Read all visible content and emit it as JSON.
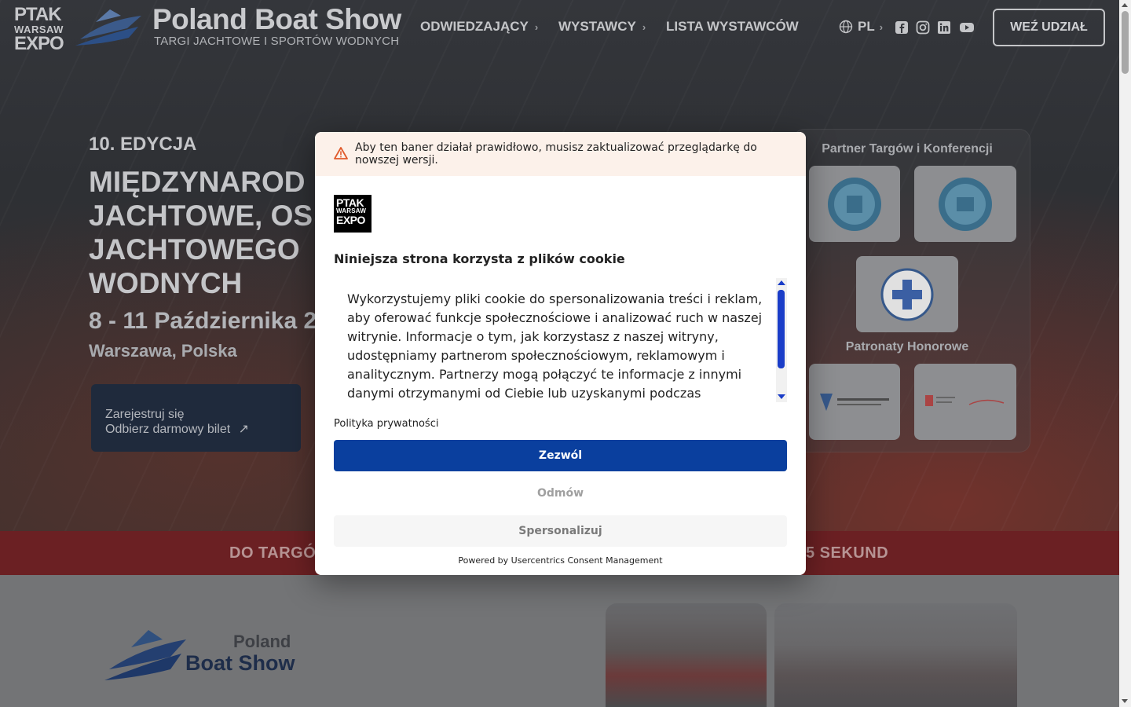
{
  "header": {
    "brand_ptak": [
      "PTAK",
      "WARSAW",
      "EXPO"
    ],
    "title": "Poland Boat Show",
    "subtitle": "TARGI JACHTOWE I SPORTÓW WODNYCH",
    "nav": [
      {
        "label": "ODWIEDZAJĄCY",
        "chevron": "›"
      },
      {
        "label": "WYSTAWCY",
        "chevron": "›"
      },
      {
        "label": "LISTA WYSTAWCÓW"
      }
    ],
    "lang": "PL",
    "lang_chevron": "›",
    "socials": [
      "facebook-icon",
      "instagram-icon",
      "linkedin-icon",
      "youtube-icon"
    ],
    "cta": "WEŹ UDZIAŁ"
  },
  "hero": {
    "edition": "10. EDYCJA",
    "title_lines": [
      "MIĘDZYNAROD",
      "JACHTOWE, OS",
      "JACHTOWEGO",
      "WODNYCH"
    ],
    "date": "8 - 11 Października 2",
    "city": "Warszawa, Polska",
    "register_line1": "Zarejestruj się",
    "register_line2": "Odbierz darmowy bilet",
    "register_arrow": "↗"
  },
  "partners": {
    "heading1": "Partner Targów i Konferencji",
    "heading2": "Patronaty Honorowe"
  },
  "countdown": {
    "left": "DO TARGÓ",
    "right": "5 SEKUND"
  },
  "lower": {
    "poland": "Poland",
    "boat_show": "Boat Show"
  },
  "cookie": {
    "warning": "Aby ten baner działał prawidłowo, musisz zaktualizować przeglądarkę do nowszej wersji.",
    "logo": [
      "PTAK",
      "WARSAW",
      "EXPO"
    ],
    "title": "Niniejsza strona korzysta z plików cookie",
    "body": "Wykorzystujemy pliki cookie do spersonalizowania treści i reklam, aby oferować funkcje społecznościowe i analizować ruch w naszej witrynie. Informacje o tym, jak korzystasz z naszej witryny, udostępniamy partnerom społecznościowym, reklamowym i analitycznym. Partnerzy mogą połączyć te informacje z innymi danymi otrzymanymi od Ciebie lub uzyskanymi podczas",
    "privacy": "Polityka prywatności",
    "allow": "Zezwól",
    "deny": "Odmów",
    "customize": "Spersonalizuj",
    "powered": "Powered by Usercentrics Consent Management"
  },
  "colors": {
    "accent_blue": "#0a3f9e",
    "countdown_red": "#6b2023",
    "warning_bg": "#fcf1ea"
  }
}
